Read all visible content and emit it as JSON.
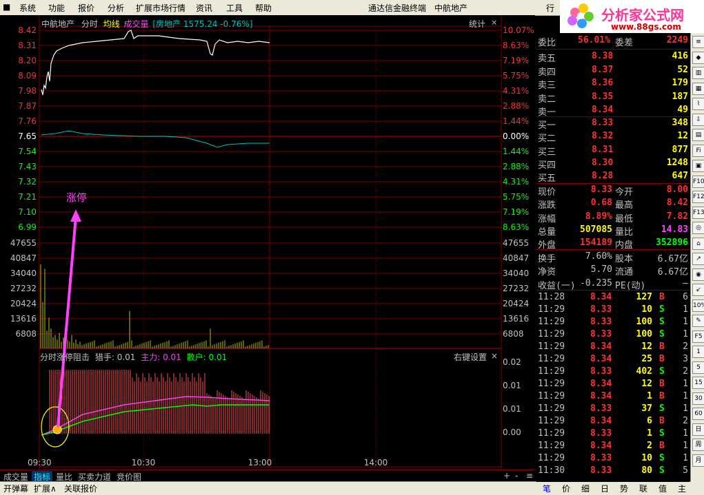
{
  "menu": [
    "系统",
    "功能",
    "报价",
    "分析",
    "扩展市场行情",
    "资讯",
    "工具",
    "帮助"
  ],
  "menu_right": {
    "app": "通达信金融终端",
    "stock": "中航地产",
    "win": "行"
  },
  "logo": {
    "title": "分析家公式网",
    "url": "www.88gs.com"
  },
  "chart_header": {
    "stock": "中航地产",
    "mode": "分时",
    "avg": "均线",
    "vol": "成交量",
    "index": "[房地产 1575.24 -0.76%]",
    "stat": "统计"
  },
  "price_axis": [
    "8.42",
    "8.31",
    "8.20",
    "8.09",
    "7.98",
    "7.87",
    "7.76",
    "7.65",
    "7.54",
    "7.43",
    "7.32",
    "7.21",
    "7.10",
    "6.99"
  ],
  "pct_axis": [
    "10.07%",
    "8.63%",
    "7.19%",
    "5.75%",
    "4.31%",
    "2.88%",
    "1.44%",
    "0.00%",
    "1.44%",
    "2.88%",
    "4.31%",
    "5.75%",
    "7.19%",
    "8.63%"
  ],
  "vol_axis": [
    "47655",
    "40847",
    "34040",
    "27232",
    "20424",
    "13616",
    "6808"
  ],
  "annotation": "涨停",
  "indicator": {
    "name": "分时涨停阻击",
    "hunter": "猎手: 0.01",
    "main": "主力: 0.01",
    "retail": "散户: 0.01",
    "settings": "右键设置",
    "close": "×",
    "axis": [
      "0.02",
      "0.01",
      "0.01",
      "0.00"
    ]
  },
  "time_axis": [
    "09:30",
    "10:30",
    "13:00",
    "14:00"
  ],
  "bottom_tabs": [
    "成交量",
    "指标",
    "量比",
    "买卖力道",
    "竞价图"
  ],
  "bottom_ctrl": [
    "+",
    "-",
    "≡"
  ],
  "status_tabs": [
    "开弹幕",
    "扩展∧",
    "关联报价"
  ],
  "right_tabs": [
    "笔",
    "价",
    "细",
    "日",
    "势",
    "联",
    "值",
    "主"
  ],
  "quote": {
    "top": {
      "wb_label": "委比",
      "wb": "56.01%",
      "wc_label": "委差",
      "wc": "2249"
    },
    "sell": [
      {
        "l": "卖五",
        "p": "8.38",
        "v": "416"
      },
      {
        "l": "卖四",
        "p": "8.37",
        "v": "52"
      },
      {
        "l": "卖三",
        "p": "8.36",
        "v": "179"
      },
      {
        "l": "卖二",
        "p": "8.35",
        "v": "187"
      },
      {
        "l": "卖一",
        "p": "8.34",
        "v": "49"
      }
    ],
    "buy": [
      {
        "l": "买一",
        "p": "8.33",
        "v": "348"
      },
      {
        "l": "买二",
        "p": "8.32",
        "v": "12"
      },
      {
        "l": "买三",
        "p": "8.31",
        "v": "877"
      },
      {
        "l": "买四",
        "p": "8.30",
        "v": "1248"
      },
      {
        "l": "买五",
        "p": "8.28",
        "v": "647"
      }
    ],
    "stats": [
      {
        "a": "现价",
        "av": "8.33",
        "b": "今开",
        "bv": "8.00"
      },
      {
        "a": "涨跌",
        "av": "0.68",
        "b": "最高",
        "bv": "8.42"
      },
      {
        "a": "涨幅",
        "av": "8.89%",
        "b": "最低",
        "bv": "7.82"
      },
      {
        "a": "总量",
        "av": "507085",
        "b": "量比",
        "bv": "14.83"
      },
      {
        "a": "外盘",
        "av": "154189",
        "b": "内盘",
        "bv": "352896"
      }
    ],
    "fund": [
      {
        "a": "换手",
        "av": "7.60%",
        "b": "股本",
        "bv": "6.67亿"
      },
      {
        "a": "净资",
        "av": "5.70",
        "b": "流通",
        "bv": "6.67亿"
      },
      {
        "a": "收益(一)",
        "av": "-0.235",
        "b": "PE(动)",
        "bv": "—"
      }
    ],
    "ticks": [
      [
        "11:28",
        "8.34",
        "127",
        "B",
        "6"
      ],
      [
        "11:29",
        "8.33",
        "10",
        "S",
        "1"
      ],
      [
        "11:29",
        "8.33",
        "100",
        "S",
        "1"
      ],
      [
        "11:29",
        "8.33",
        "100",
        "S",
        "1"
      ],
      [
        "11:29",
        "8.34",
        "12",
        "B",
        "2"
      ],
      [
        "11:29",
        "8.34",
        "25",
        "B",
        "3"
      ],
      [
        "11:29",
        "8.33",
        "402",
        "S",
        "2"
      ],
      [
        "11:29",
        "8.34",
        "12",
        "B",
        "1"
      ],
      [
        "11:29",
        "8.34",
        "1",
        "B",
        "1"
      ],
      [
        "11:29",
        "8.33",
        "37",
        "S",
        "1"
      ],
      [
        "11:29",
        "8.34",
        "6",
        "B",
        "2"
      ],
      [
        "11:29",
        "8.33",
        "1",
        "S",
        "1"
      ],
      [
        "11:29",
        "8.34",
        "2",
        "B",
        "1"
      ],
      [
        "11:29",
        "8.33",
        "10",
        "S",
        "1"
      ],
      [
        "11:30",
        "8.33",
        "80",
        "S",
        "5"
      ]
    ]
  },
  "side_toolbar": [
    "Fi",
    "F10",
    "F12",
    "F13",
    "10%",
    "F5",
    "1",
    "5",
    "15",
    "30",
    "60",
    "日",
    "周",
    "月"
  ],
  "colors": {
    "grid": "#800000",
    "up": "#ff3030",
    "down": "#00ff00",
    "price": "#ffffff",
    "avg": "#00c0c0",
    "pink": "#ff40ff",
    "yellow": "#ffff00",
    "vol": "#c0c000"
  }
}
